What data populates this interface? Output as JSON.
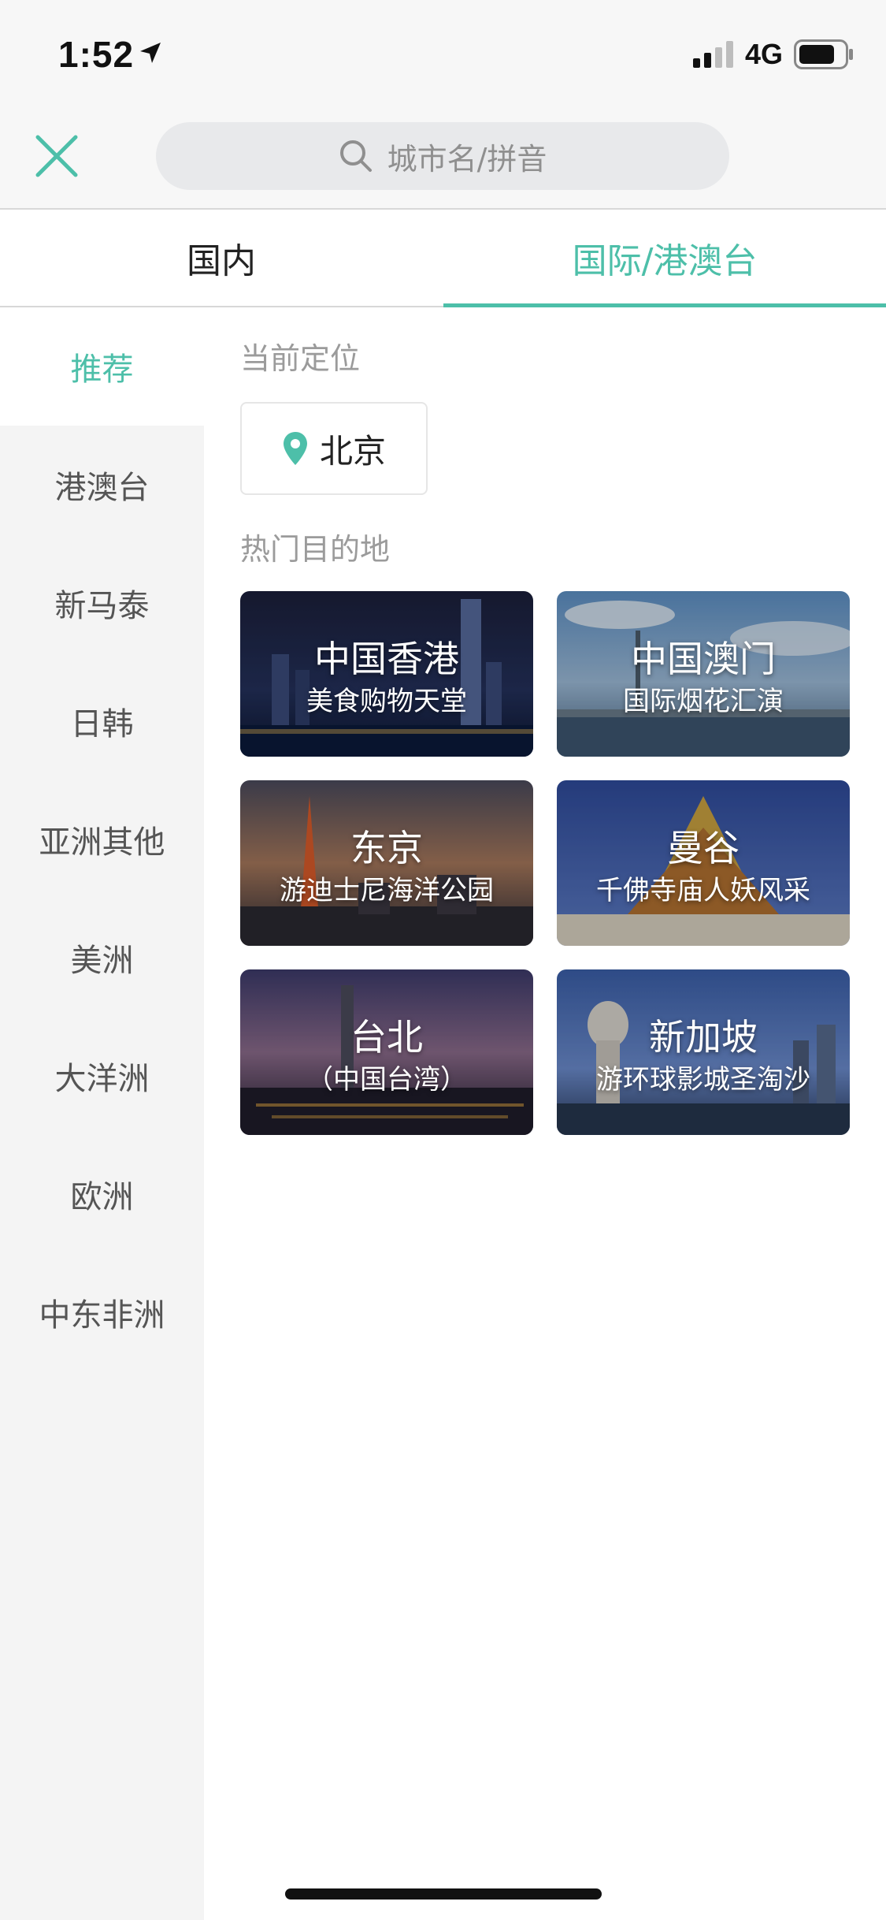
{
  "status_bar": {
    "time": "1:52",
    "network": "4G",
    "icons": [
      "location-arrow-icon",
      "signal-bars-icon",
      "battery-icon"
    ]
  },
  "header": {
    "close_icon": "close-icon",
    "search": {
      "placeholder": "城市名/拼音",
      "icon": "search-icon"
    }
  },
  "tabs": [
    {
      "label": "国内",
      "active": false
    },
    {
      "label": "国际/港澳台",
      "active": true
    }
  ],
  "sidebar": {
    "items": [
      {
        "label": "推荐",
        "active": true
      },
      {
        "label": "港澳台",
        "active": false
      },
      {
        "label": "新马泰",
        "active": false
      },
      {
        "label": "日韩",
        "active": false
      },
      {
        "label": "亚洲其他",
        "active": false
      },
      {
        "label": "美洲",
        "active": false
      },
      {
        "label": "大洋洲",
        "active": false
      },
      {
        "label": "欧洲",
        "active": false
      },
      {
        "label": "中东非洲",
        "active": false
      }
    ]
  },
  "main": {
    "current_location_label": "当前定位",
    "current_location": "北京",
    "hot_label": "热门目的地",
    "destinations": [
      {
        "title": "中国香港",
        "subtitle": "美食购物天堂"
      },
      {
        "title": "中国澳门",
        "subtitle": "国际烟花汇演"
      },
      {
        "title": "东京",
        "subtitle": "游迪士尼海洋公园"
      },
      {
        "title": "曼谷",
        "subtitle": "千佛寺庙人妖风采"
      },
      {
        "title": "台北",
        "subtitle": "（中国台湾）"
      },
      {
        "title": "新加坡",
        "subtitle": "游环球影城圣淘沙"
      }
    ]
  },
  "colors": {
    "accent": "#4dbfa9",
    "sidebar_bg": "#f4f4f4",
    "header_bg": "#f7f7f7"
  }
}
